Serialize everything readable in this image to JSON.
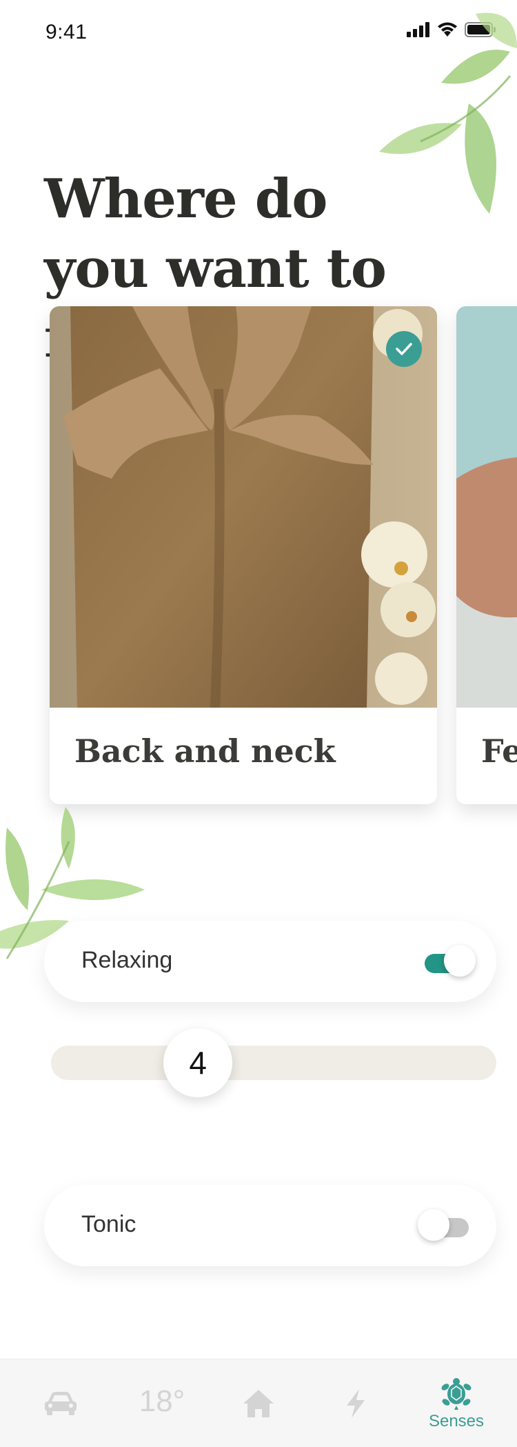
{
  "status_bar": {
    "time": "9:41"
  },
  "header": {
    "title": "Where do you want to relax ?"
  },
  "cards": [
    {
      "label": "Back and neck",
      "selected": true,
      "image": "back-massage-photo"
    },
    {
      "label": "Fe",
      "selected": false,
      "image": "feet-photo"
    }
  ],
  "settings": {
    "relaxing": {
      "label": "Relaxing",
      "enabled": true
    },
    "intensity": {
      "value": "4",
      "level_fraction": 0.33
    },
    "tonic": {
      "label": "Tonic",
      "enabled": false
    }
  },
  "tabbar": {
    "items": [
      {
        "icon": "car-icon",
        "label": ""
      },
      {
        "icon": "temperature",
        "label": "18°"
      },
      {
        "icon": "home-icon",
        "label": ""
      },
      {
        "icon": "bolt-icon",
        "label": ""
      },
      {
        "icon": "turtle-icon",
        "label": "Senses",
        "active": true
      }
    ]
  },
  "colors": {
    "accent": "#239485",
    "text": "#2d2d2a",
    "slider_track": "#f0ede6",
    "inactive_icon": "#d4d4d4"
  }
}
